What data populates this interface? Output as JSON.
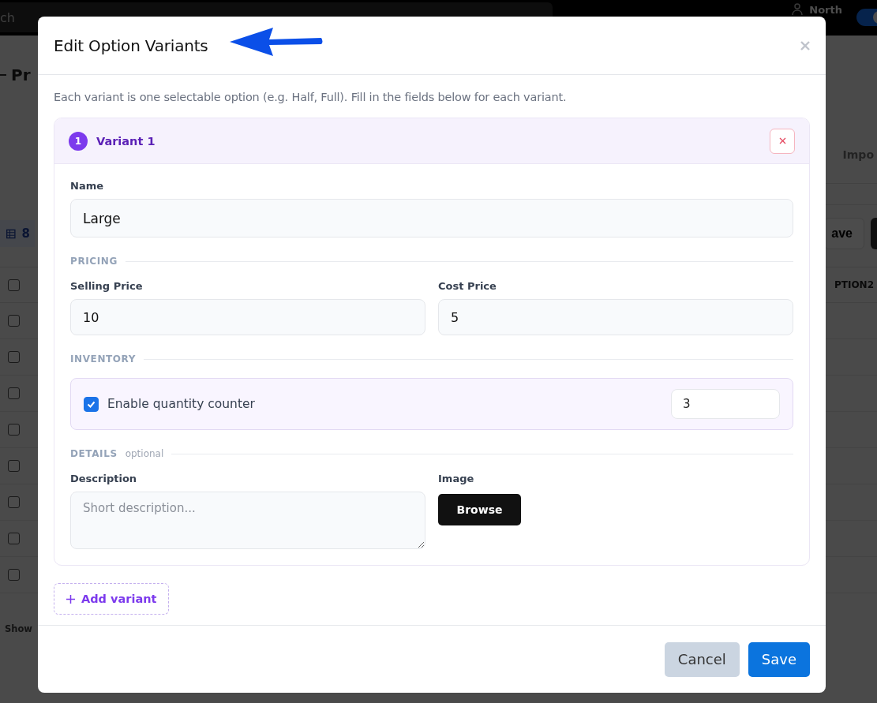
{
  "background": {
    "search_text": "ch",
    "user": "North",
    "toggle_on": true,
    "page_title": "Pr",
    "import_button": "Impo",
    "rows_chip": "8",
    "save_button": "ave",
    "header_checked": false,
    "column": "PTION2",
    "rows": [
      {
        "checked": false
      },
      {
        "checked": false
      },
      {
        "checked": false
      },
      {
        "checked": false
      },
      {
        "checked": false
      },
      {
        "checked": false
      },
      {
        "checked": false
      },
      {
        "checked": false
      }
    ],
    "footer_text": "Show"
  },
  "modal": {
    "title": "Edit Option Variants",
    "description": "Each variant is one selectable option (e.g. Half, Full). Fill in the fields below for each variant.",
    "variants": [
      {
        "badge": "1",
        "title": "Variant 1",
        "name": {
          "label": "Name",
          "value": "Large"
        },
        "pricing": {
          "heading": "PRICING",
          "selling": {
            "label": "Selling Price",
            "value": "10"
          },
          "cost": {
            "label": "Cost Price",
            "value": "5"
          }
        },
        "inventory": {
          "heading": "INVENTORY",
          "counter": {
            "label": "Enable quantity counter",
            "checked": true,
            "value": "3"
          }
        },
        "details": {
          "heading": "DETAILS",
          "note": "optional",
          "description": {
            "label": "Description",
            "placeholder": "Short description..."
          },
          "image": {
            "label": "Image",
            "button": "Browse"
          }
        }
      }
    ],
    "add_button": "Add variant",
    "buttons": [
      {
        "label": "Cancel",
        "kind": "secondary"
      },
      {
        "label": "Save",
        "kind": "primary"
      }
    ]
  }
}
